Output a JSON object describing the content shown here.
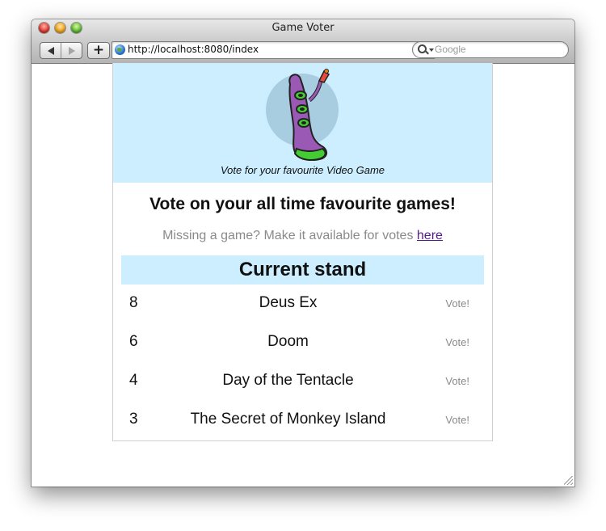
{
  "window": {
    "title": "Game Voter"
  },
  "toolbar": {
    "back_glyph": "◀",
    "forward_glyph": "▶",
    "add_label": "+",
    "url": "http://localhost:8080/index",
    "reload_glyph": "↻",
    "search_placeholder": "Google"
  },
  "page": {
    "tagline": "Vote for your favourite Video Game",
    "headline": "Vote on your all time favourite games!",
    "missing_text": "Missing a game? Make it available for votes ",
    "missing_link": "here",
    "stand_title": "Current stand",
    "games": [
      {
        "votes": "8",
        "title": "Deus Ex",
        "vote_label": "Vote!"
      },
      {
        "votes": "6",
        "title": "Doom",
        "vote_label": "Vote!"
      },
      {
        "votes": "4",
        "title": "Day of the Tentacle",
        "vote_label": "Vote!"
      },
      {
        "votes": "3",
        "title": "The Secret of Monkey Island",
        "vote_label": "Vote!"
      }
    ]
  },
  "colors": {
    "banner": "#cceeff",
    "muted_text": "#8a8a8a",
    "visited_link": "#551a8b",
    "mascot_body": "#9b59b6",
    "mascot_suckers": "#44cc33"
  },
  "icons": {
    "close": "close-button-icon",
    "minimize": "minimize-button-icon",
    "zoom": "zoom-button-icon",
    "globe": "globe-icon",
    "reload": "reload-icon",
    "search": "magnifier-icon",
    "mascot": "purple-tentacle-icon"
  }
}
